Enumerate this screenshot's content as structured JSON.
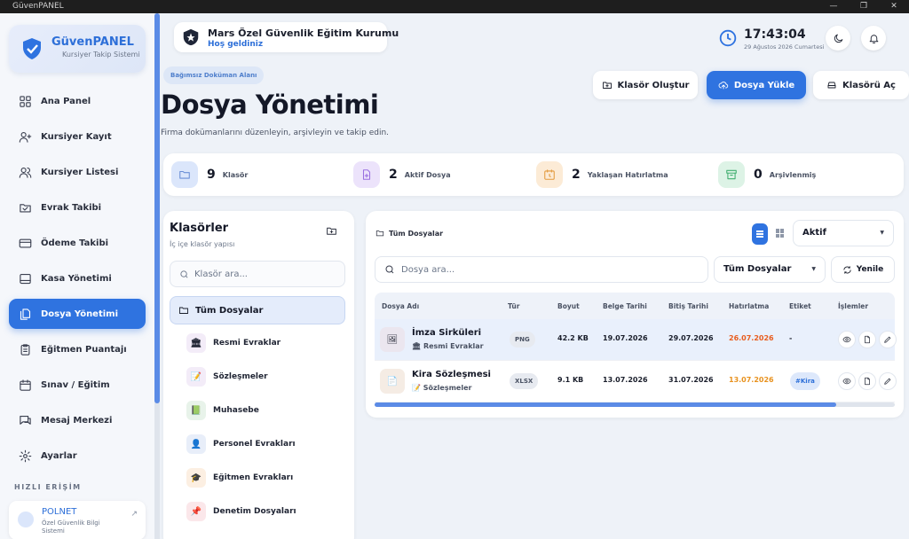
{
  "window": {
    "title": "GüvenPANEL"
  },
  "brand": {
    "name": "GüvenPANEL",
    "subtitle": "Kursiyer Takip Sistemi"
  },
  "nav": [
    {
      "label": "Ana Panel",
      "icon": "grid-icon"
    },
    {
      "label": "Kursiyer Kayıt",
      "icon": "user-plus-icon"
    },
    {
      "label": "Kursiyer Listesi",
      "icon": "users-icon"
    },
    {
      "label": "Evrak Takibi",
      "icon": "folder-check-icon"
    },
    {
      "label": "Ödeme Takibi",
      "icon": "credit-card-icon"
    },
    {
      "label": "Kasa Yönetimi",
      "icon": "cash-register-icon"
    },
    {
      "label": "Dosya Yönetimi",
      "icon": "files-icon",
      "active": true
    },
    {
      "label": "Eğitmen Puantajı",
      "icon": "clipboard-icon"
    },
    {
      "label": "Sınav / Eğitim",
      "icon": "calendar-icon"
    },
    {
      "label": "Mesaj Merkezi",
      "icon": "message-icon"
    },
    {
      "label": "Ayarlar",
      "icon": "gear-icon"
    }
  ],
  "quick_access": {
    "title": "HIZLI ERİŞİM",
    "item": {
      "name": "POLNET",
      "subtitle": "Özel Güvenlik Bilgi Sistemi"
    }
  },
  "header": {
    "org_name": "Mars Özel Güvenlik Eğitim Kurumu",
    "welcome": "Hoş geldiniz",
    "time": "17:43:04",
    "date": "29 Ağustos 2026 Cumartesi"
  },
  "page": {
    "badge": "Bağımsız Doküman Alanı",
    "title": "Dosya Yönetimi",
    "subtitle": "Firma dokümanlarını düzenleyin, arşivleyin ve takip edin.",
    "buttons": {
      "create_folder": "Klasör Oluştur",
      "upload": "Dosya Yükle",
      "open_folder": "Klasörü Aç"
    }
  },
  "stats": [
    {
      "value": "9",
      "label": "Klasör",
      "color": "#dbe6fb",
      "stroke": "#6b8fd6"
    },
    {
      "value": "2",
      "label": "Aktif Dosya",
      "color": "#ece3fb",
      "stroke": "#9a6fe0"
    },
    {
      "value": "2",
      "label": "Yaklaşan Hatırlatma",
      "color": "#fcebd6",
      "stroke": "#e39a3c"
    },
    {
      "value": "0",
      "label": "Arşivlenmiş",
      "color": "#ddf3e6",
      "stroke": "#3fae6e"
    }
  ],
  "folders": {
    "title": "Klasörler",
    "subtitle": "İç içe klasör yapısı",
    "search_placeholder": "Klasör ara...",
    "all_label": "Tüm Dosyalar",
    "items": [
      {
        "label": "Resmi Evraklar",
        "emoji": "🏛",
        "bg": "#f3ecf8"
      },
      {
        "label": "Sözleşmeler",
        "emoji": "📝",
        "bg": "#f3ecf8"
      },
      {
        "label": "Muhasebe",
        "emoji": "📗",
        "bg": "#e8f3ea"
      },
      {
        "label": "Personel Evrakları",
        "emoji": "👤",
        "bg": "#e8eef9"
      },
      {
        "label": "Eğitmen Evrakları",
        "emoji": "🎓",
        "bg": "#fcefe2"
      },
      {
        "label": "Denetim Dosyaları",
        "emoji": "📌",
        "bg": "#fbe7ea"
      }
    ]
  },
  "files": {
    "crumb": "Tüm Dosyalar",
    "status_filter": "Aktif",
    "search_placeholder": "Dosya ara...",
    "type_filter": "Tüm Dosyalar",
    "refresh": "Yenile",
    "columns": [
      "Dosya Adı",
      "Tür",
      "Boyut",
      "Belge Tarihi",
      "Bitiş Tarihi",
      "Hatırlatma",
      "Etiket",
      "İşlemler"
    ],
    "rows": [
      {
        "name": "İmza Sirküleri",
        "folder": "Resmi Evraklar",
        "type": "PNG",
        "size": "42.2 KB",
        "doc_date": "19.07.2026",
        "end_date": "29.07.2026",
        "reminder": "26.07.2026",
        "reminder_color": "#e85d1f",
        "tag": "-"
      },
      {
        "name": "Kira Sözleşmesi",
        "folder": "Sözleşmeler",
        "type": "XLSX",
        "size": "9.1 KB",
        "doc_date": "13.07.2026",
        "end_date": "31.07.2026",
        "reminder": "13.07.2026",
        "reminder_color": "#e8921f",
        "tag": "#Kira"
      }
    ]
  }
}
